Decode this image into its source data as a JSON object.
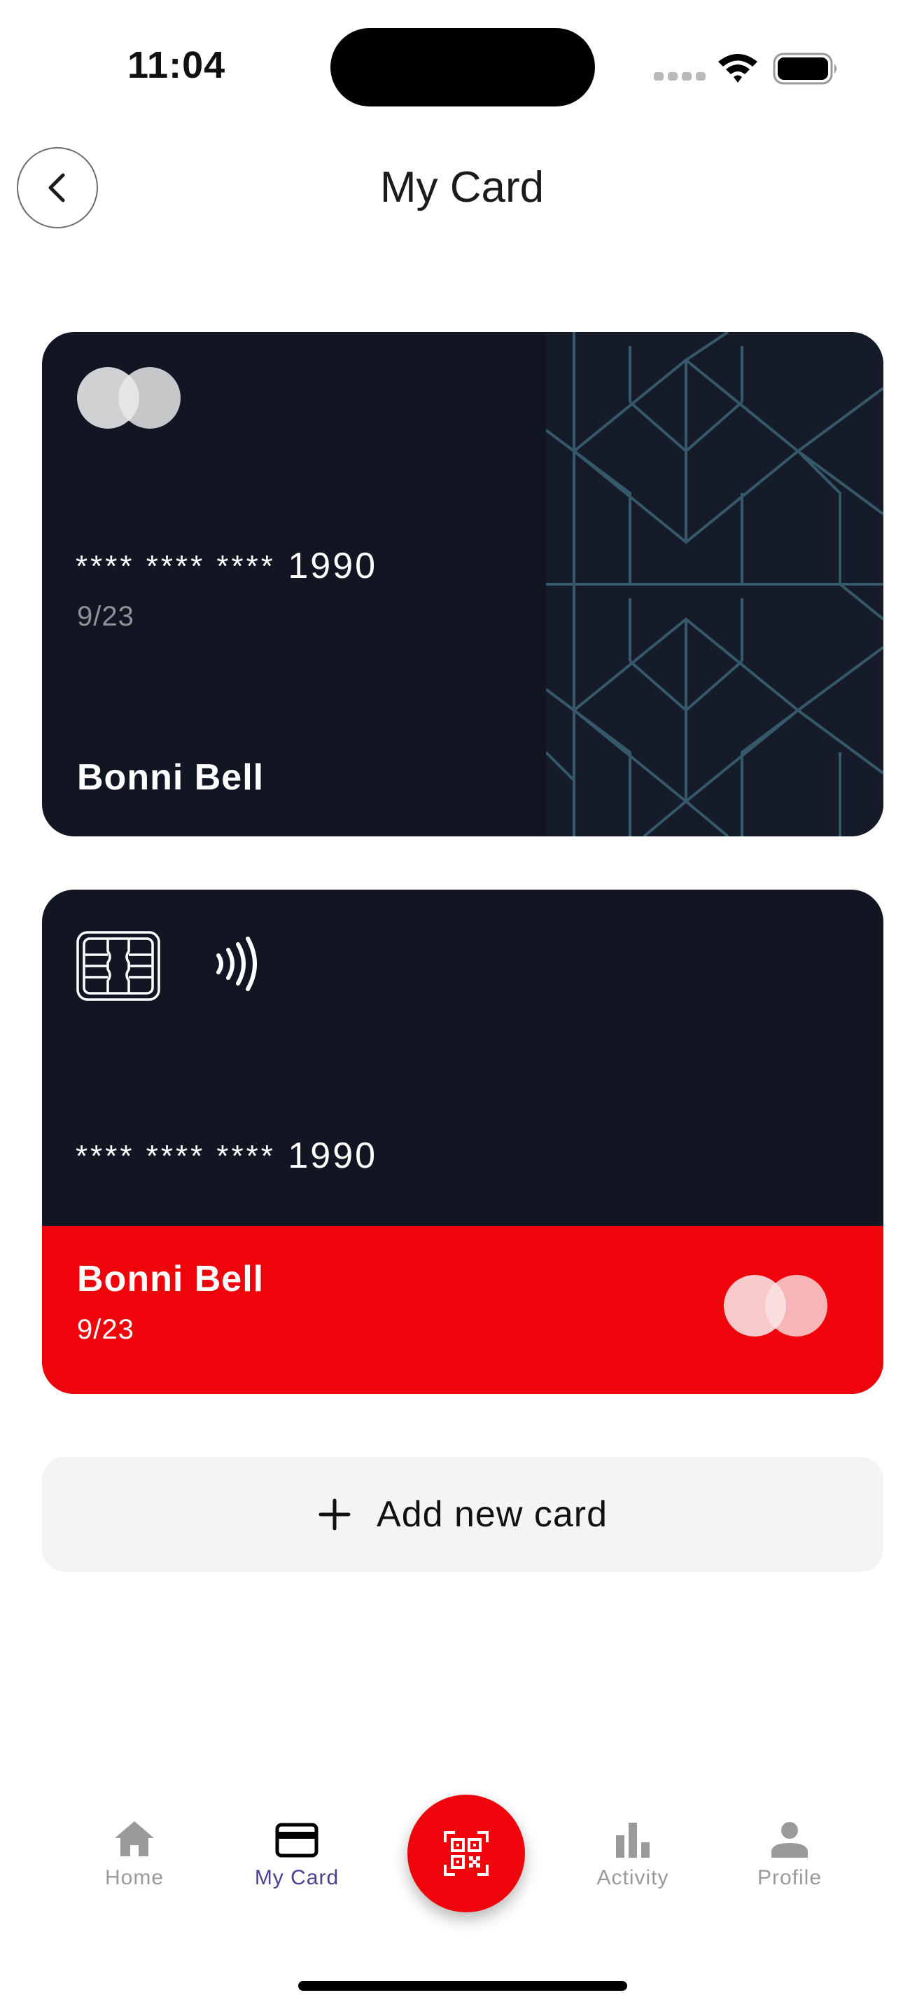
{
  "status_bar": {
    "time": "11:04"
  },
  "header": {
    "title": "My Card"
  },
  "cards": [
    {
      "number_mask": "**** **** ****",
      "number_last4": "1990",
      "expiry": "9/23",
      "holder": "Bonni Bell",
      "brand_icon": "mastercard-logo-icon",
      "colors": {
        "background": "#121623",
        "pattern": "#35596a"
      }
    },
    {
      "number_mask": "**** **** ****",
      "number_last4": "1990",
      "expiry": "9/23",
      "holder": "Bonni Bell",
      "brand_icon": "mastercard-logo-icon",
      "colors": {
        "background": "#121623",
        "accent": "#f0040b"
      }
    }
  ],
  "add_card": {
    "label": "Add new card"
  },
  "bottom_nav": {
    "items": [
      {
        "label": "Home",
        "icon": "home-icon",
        "active": false
      },
      {
        "label": "My Card",
        "icon": "card-icon",
        "active": true
      },
      {
        "label": "Activity",
        "icon": "bar-chart-icon",
        "active": false
      },
      {
        "label": "Profile",
        "icon": "person-icon",
        "active": false
      }
    ],
    "center_action_icon": "qr-scan-icon"
  },
  "colors": {
    "brand_red": "#f0040b",
    "active_nav": "#4b3f8f",
    "inactive_nav": "#9a9a9a"
  }
}
